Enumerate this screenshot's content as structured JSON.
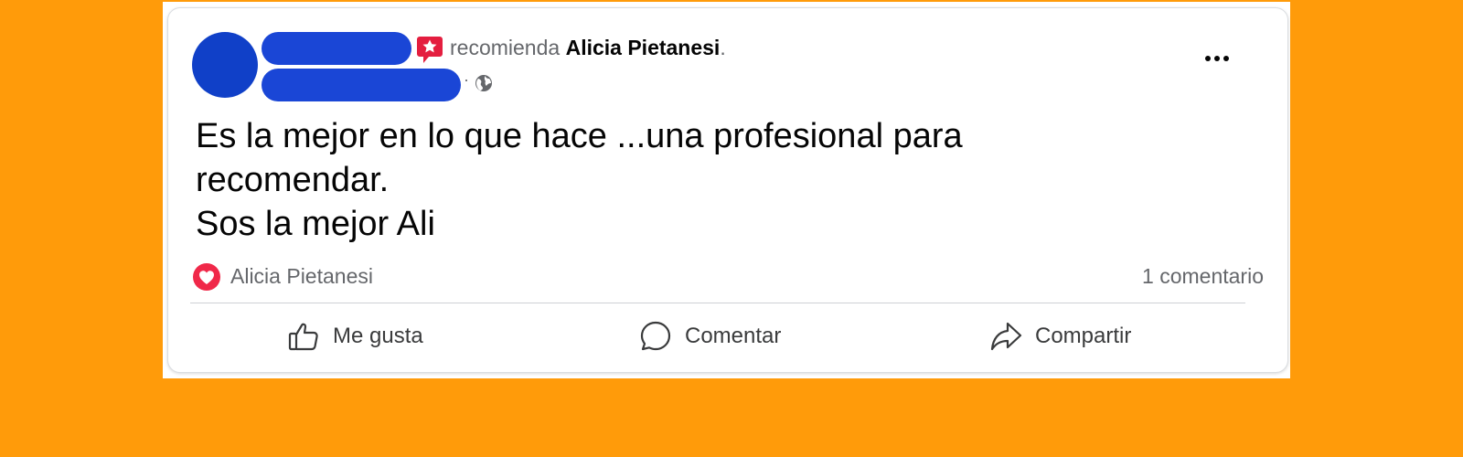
{
  "post": {
    "header": {
      "action_text": "recomienda",
      "page_name": "Alicia Pietanesi",
      "period": ".",
      "meta_separator": "·",
      "privacy_icon": "globe-icon",
      "recommend_icon": "recommend-icon",
      "more_icon": "more-options-icon"
    },
    "body": {
      "lines": [
        "Es la mejor en lo que hace ...una profesional para",
        "recomendar.",
        "Sos la mejor Ali"
      ]
    },
    "reactions": {
      "icon": "heart-reaction-icon",
      "reactor_name": "Alicia Pietanesi",
      "comment_count_text": "1 comentario"
    },
    "actions": {
      "like_label": "Me gusta",
      "comment_label": "Comentar",
      "share_label": "Compartir"
    }
  },
  "colors": {
    "background": "#FF9B0A",
    "redaction": "#1A46D6",
    "reaction_red": "#F02849",
    "recommend_pink": "#E41E3F",
    "secondary_text": "#65676B"
  }
}
